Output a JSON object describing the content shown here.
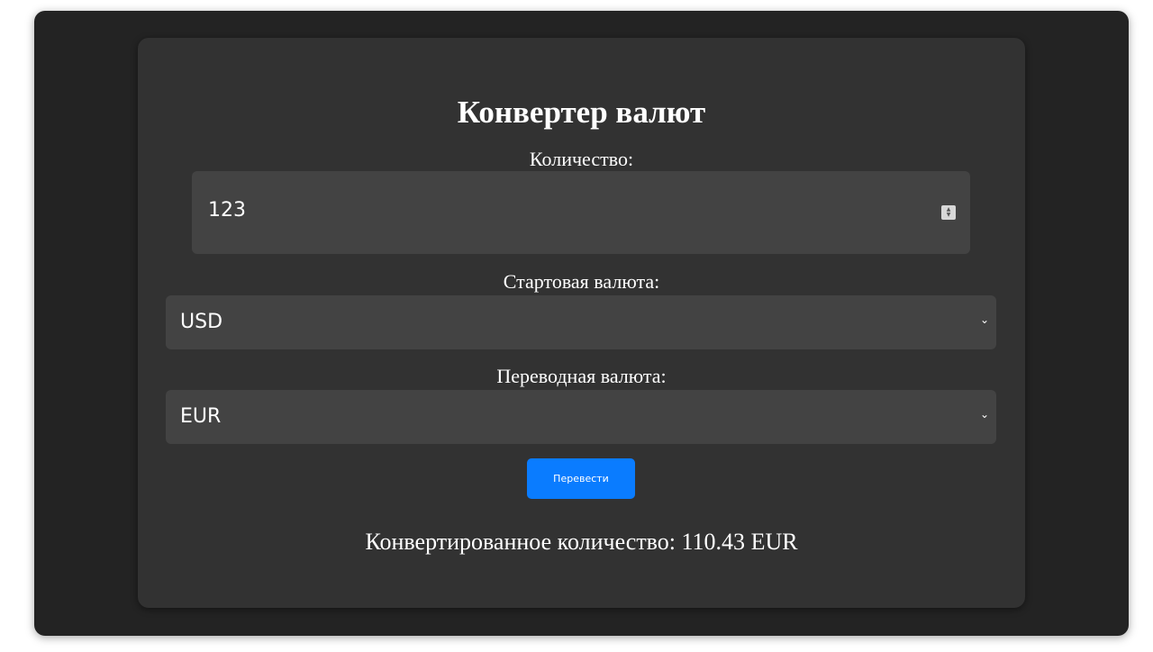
{
  "converter": {
    "title": "Конвертер валют",
    "amount_label": "Количество:",
    "amount_value": "123",
    "from_label": "Стартовая валюта:",
    "from_value": "USD",
    "to_label": "Переводная валюта:",
    "to_value": "EUR",
    "convert_button": "Перевести",
    "result_prefix": "Конвертированное количество:",
    "result_value": "110.43",
    "result_currency": "EUR"
  },
  "icons": {
    "spinner": "number-spinner-icon",
    "chevron": "chevron-down-icon"
  },
  "colors": {
    "background": "#232323",
    "card": "#323232",
    "field": "#434343",
    "button": "#0a7cff",
    "text": "#ffffff"
  }
}
